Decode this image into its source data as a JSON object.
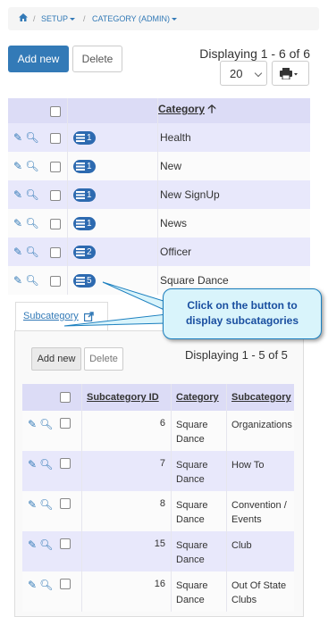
{
  "breadcrumb": {
    "setup": "SETUP",
    "category": "CATEGORY (ADMIN)"
  },
  "toolbar": {
    "add_label": "Add new",
    "delete_label": "Delete",
    "display_text": "Displaying 1 - 6 of 6",
    "page_size": "20"
  },
  "main_table": {
    "header": "Category",
    "rows": [
      {
        "count": "1",
        "category": "Health"
      },
      {
        "count": "1",
        "category": "New"
      },
      {
        "count": "1",
        "category": "New SignUp"
      },
      {
        "count": "1",
        "category": "News"
      },
      {
        "count": "2",
        "category": "Officer"
      },
      {
        "count": "5",
        "category": "Square Dance"
      }
    ]
  },
  "sub_tab": {
    "label": "Subcategory"
  },
  "subpanel": {
    "add_label": "Add new",
    "delete_label": "Delete",
    "display_text": "Displaying 1 - 5 of 5",
    "headers": {
      "id": "Subcategory ID",
      "category": "Category",
      "subcategory": "Subcategory"
    },
    "rows": [
      {
        "id": "6",
        "cat1": "Square",
        "cat2": "Dance",
        "sub1": "Organizations",
        "sub2": ""
      },
      {
        "id": "7",
        "cat1": "Square",
        "cat2": "Dance",
        "sub1": "How To",
        "sub2": ""
      },
      {
        "id": "8",
        "cat1": "Square",
        "cat2": "Dance",
        "sub1": "Convention /",
        "sub2": "Events"
      },
      {
        "id": "15",
        "cat1": "Square",
        "cat2": "Dance",
        "sub1": "Club",
        "sub2": ""
      },
      {
        "id": "16",
        "cat1": "Square",
        "cat2": "Dance",
        "sub1": "Out Of State",
        "sub2": "Clubs"
      }
    ]
  },
  "callout": {
    "line1": "Click on the button to",
    "line2": "display subcatagories"
  },
  "colors": {
    "primary": "#337ab7",
    "row_alt": "#e8e8fb",
    "callout_bg": "#d9f4fb"
  }
}
